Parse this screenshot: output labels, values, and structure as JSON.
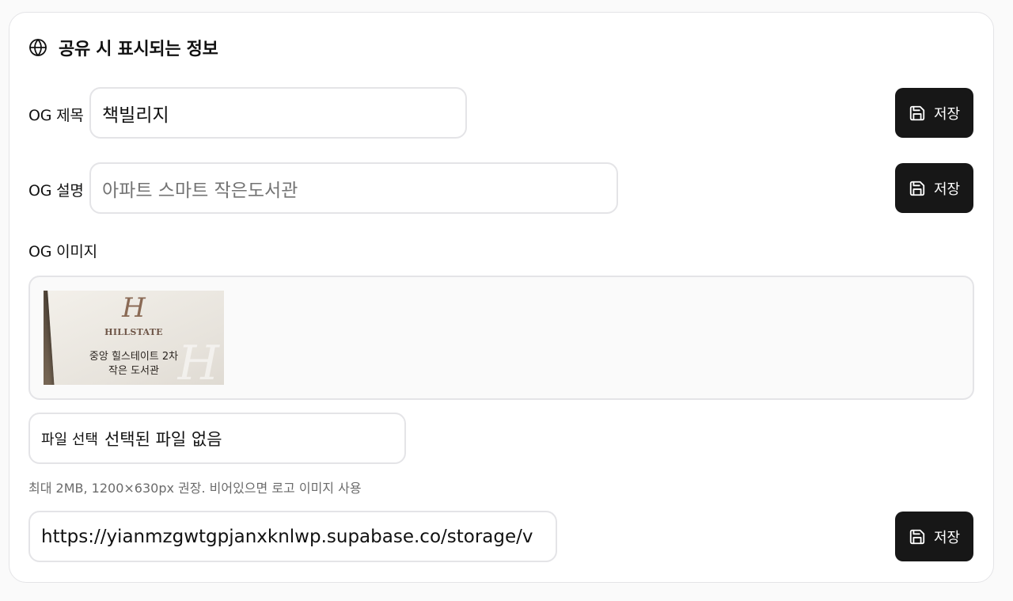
{
  "section": {
    "title": "공유 시 표시되는 정보",
    "icon": "globe-icon"
  },
  "og_title": {
    "label": "OG 제목",
    "value": "책빌리지",
    "save_label": "저장"
  },
  "og_description": {
    "label": "OG 설명",
    "placeholder": "아파트 스마트 작은도서관",
    "save_label": "저장"
  },
  "og_image": {
    "label": "OG 이미지",
    "preview": {
      "brand": "HILLSTATE",
      "caption_line1": "중앙 힐스테이트 2차",
      "caption_line2": "작은 도서관"
    },
    "file_button": "파일 선택",
    "file_status": "선택된 파일 없음",
    "hint": "최대 2MB, 1200×630px 권장. 비어있으면 로고 이미지 사용",
    "url_value": "https://yianmzgwtgpjanxknlwp.supabase.co/storage/v",
    "save_label": "저장"
  },
  "colors": {
    "button_bg": "#171717",
    "border": "#e4e4e7",
    "placeholder": "#737373"
  }
}
